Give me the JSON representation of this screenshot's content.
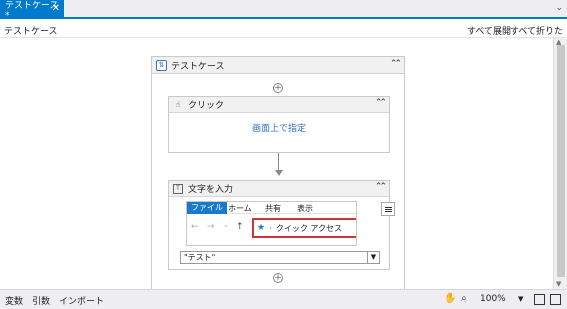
{
  "tabs": [
    {
      "label": "テストケース *",
      "close_glyph": "✕"
    }
  ],
  "tab_overflow_glyph": "⌄",
  "toolbar": {
    "breadcrumb": "テストケース",
    "expand_all": "すべて展開",
    "collapse_all": "すべて折りたたみ"
  },
  "sequence": {
    "title": "テストケース",
    "collapse_glyph": "⌃⌃",
    "add_glyph": "+",
    "activities": [
      {
        "title": "クリック",
        "body_link": "画面上で指定"
      },
      {
        "title": "文字を入力"
      }
    ]
  },
  "type_into": {
    "preview": {
      "tabs": [
        "ファイル",
        "ホーム",
        "共有",
        "表示"
      ],
      "active_tab_index": 0,
      "nav": [
        "←",
        "→",
        "⌄",
        "↑"
      ],
      "highlight_text": "クイック アクセス",
      "highlight_sep": "›"
    },
    "text_value": "\"テスト\""
  },
  "statusbar": {
    "items": [
      "変数",
      "引数",
      "インポート"
    ],
    "zoom": "100%"
  },
  "icons": {
    "hand": "hand-icon",
    "search": "search-icon",
    "fit": "fit-screen-icon",
    "overview": "overview-icon",
    "click": "click-icon",
    "type": "type-into-icon",
    "sequence": "sequence-icon",
    "star": "star-icon"
  },
  "colors": {
    "accent": "#007acc",
    "highlight_border": "#d13438",
    "link": "#2f6fb6"
  }
}
